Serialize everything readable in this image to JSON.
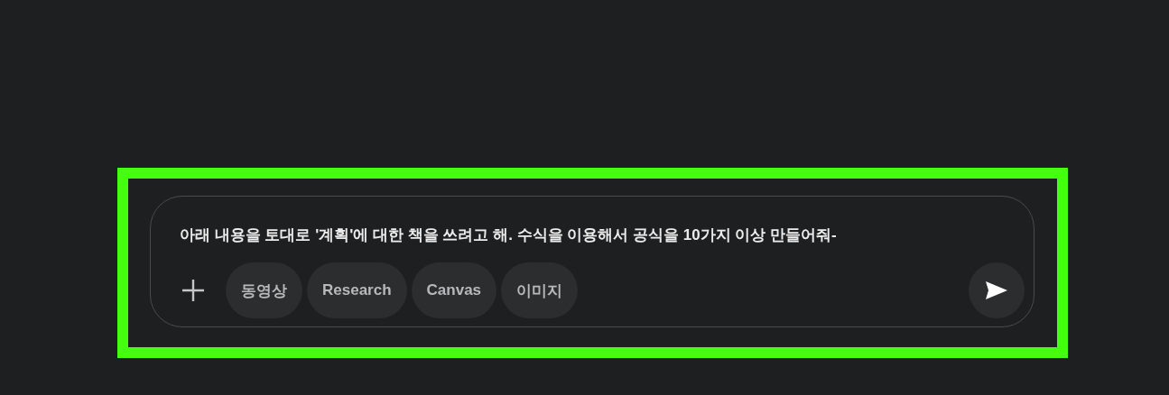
{
  "highlight": {
    "color": "#44ff10"
  },
  "prompt": {
    "value": "아래 내용을 토대로 '계획'에 대한 책을 쓰려고 해. 수식을 이용해서 공식을 10가지 이상 만들어줘-"
  },
  "tools": [
    {
      "label": "동영상"
    },
    {
      "label": "Research"
    },
    {
      "label": "Canvas"
    },
    {
      "label": "이미지"
    }
  ]
}
